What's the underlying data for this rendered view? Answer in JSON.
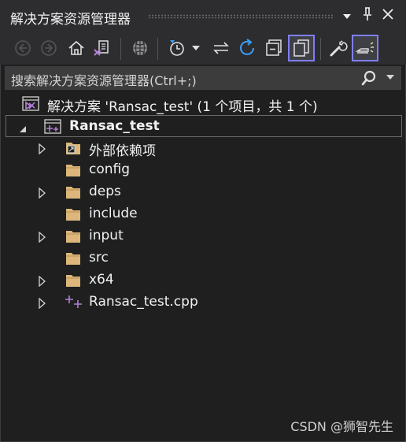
{
  "window": {
    "title": "解决方案资源管理器",
    "controls": {
      "dropdown": "▾",
      "pin": "📌",
      "close": "✕"
    }
  },
  "toolbar": {
    "icons": [
      "back-icon",
      "forward-icon",
      "home-icon",
      "switch-views-icon",
      "git-globe-icon",
      "pending-changes-filter-icon",
      "dropdown-icon",
      "sync-icon",
      "refresh-icon",
      "collapse-all-icon",
      "show-all-files-icon",
      "properties-wrench-icon",
      "preview-selected-icon"
    ]
  },
  "search": {
    "placeholder": "搜索解决方案资源管理器(Ctrl+;)"
  },
  "tree": {
    "solution": "解决方案 'Ransac_test' (1 个项目，共 1 个)",
    "project": "Ransac_test",
    "items": [
      {
        "label": "外部依赖项",
        "type": "external",
        "expandable": true
      },
      {
        "label": "config",
        "type": "folder",
        "expandable": false
      },
      {
        "label": "deps",
        "type": "folder",
        "expandable": true
      },
      {
        "label": "include",
        "type": "folder",
        "expandable": false
      },
      {
        "label": "input",
        "type": "folder",
        "expandable": true
      },
      {
        "label": "src",
        "type": "folder",
        "expandable": false
      },
      {
        "label": "x64",
        "type": "folder",
        "expandable": true
      },
      {
        "label": "Ransac_test.cpp",
        "type": "cpp",
        "expandable": true
      }
    ]
  },
  "watermark": "CSDN @狮智先生",
  "colors": {
    "accent": "#7f7ffb",
    "background": "#1f1f1f",
    "folder": "#dcb67a",
    "cpp": "#b180d7"
  }
}
